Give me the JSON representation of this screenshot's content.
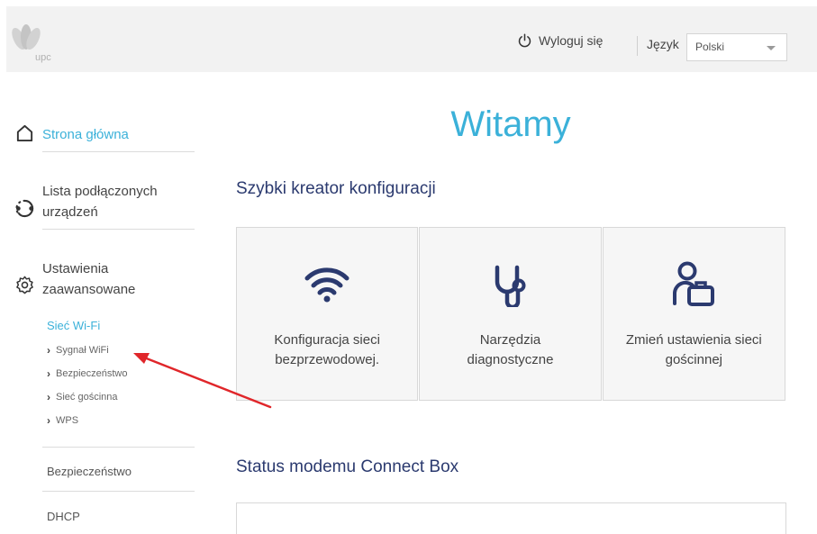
{
  "header": {
    "logo_text": "upc",
    "logout_label": "Wyloguj się",
    "language_label": "Język",
    "language_selected": "Polski"
  },
  "sidebar": {
    "home": "Strona główna",
    "devices_line1": "Lista podłączonych",
    "devices_line2": "urządzeń",
    "advanced_line1": "Ustawienia",
    "advanced_line2": "zaawansowane",
    "wifi_heading": "Sieć Wi-Fi",
    "wifi_items": [
      "Sygnał WiFi",
      "Bezpieczeństwo",
      "Sieć gościnna",
      "WPS"
    ],
    "security": "Bezpieczeństwo",
    "dhcp": "DHCP"
  },
  "main": {
    "welcome": "Witamy",
    "wizard_title": "Szybki kreator konfiguracji",
    "cards": [
      {
        "line1": "Konfiguracja sieci",
        "line2": "bezprzewodowej.",
        "icon": "wifi-icon"
      },
      {
        "line1": "Narzędzia",
        "line2": "diagnostyczne",
        "icon": "stethoscope-icon"
      },
      {
        "line1": "Zmień ustawienia sieci",
        "line2": "gościnnej",
        "icon": "guest-luggage-icon"
      }
    ],
    "status_title": "Status modemu Connect Box"
  },
  "colors": {
    "accent": "#3bb1d9",
    "navy": "#2b3a6f",
    "arrow": "#e0262a"
  }
}
